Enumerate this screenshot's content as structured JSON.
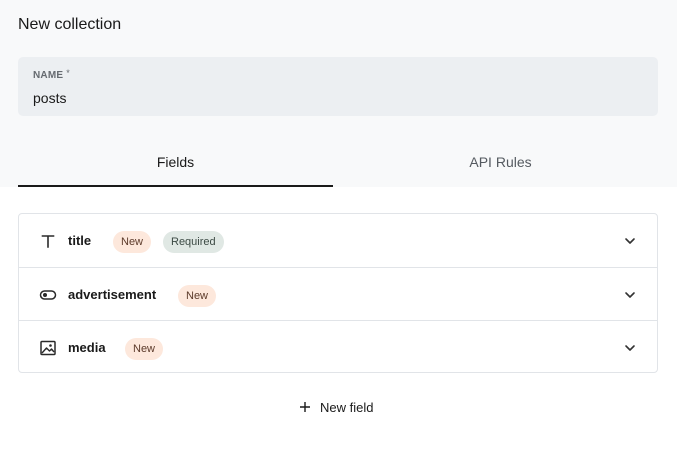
{
  "panel": {
    "title": "New collection"
  },
  "name_field": {
    "label": "NAME",
    "required_marker": "*",
    "value": "posts"
  },
  "tabs": [
    {
      "label": "Fields",
      "active": true
    },
    {
      "label": "API Rules",
      "active": false
    }
  ],
  "fields": [
    {
      "name": "title",
      "icon": "text-type-icon",
      "badges": [
        "New",
        "Required"
      ]
    },
    {
      "name": "advertisement",
      "icon": "toggle-icon",
      "badges": [
        "New"
      ]
    },
    {
      "name": "media",
      "icon": "image-icon",
      "badges": [
        "New"
      ]
    }
  ],
  "new_field_button": {
    "label": "New field",
    "icon": "plus-icon"
  },
  "colors": {
    "badge_new_bg": "#fde8dc",
    "badge_required_bg": "#e0e8e4",
    "active_tab_underline": "#1a1a1a"
  }
}
